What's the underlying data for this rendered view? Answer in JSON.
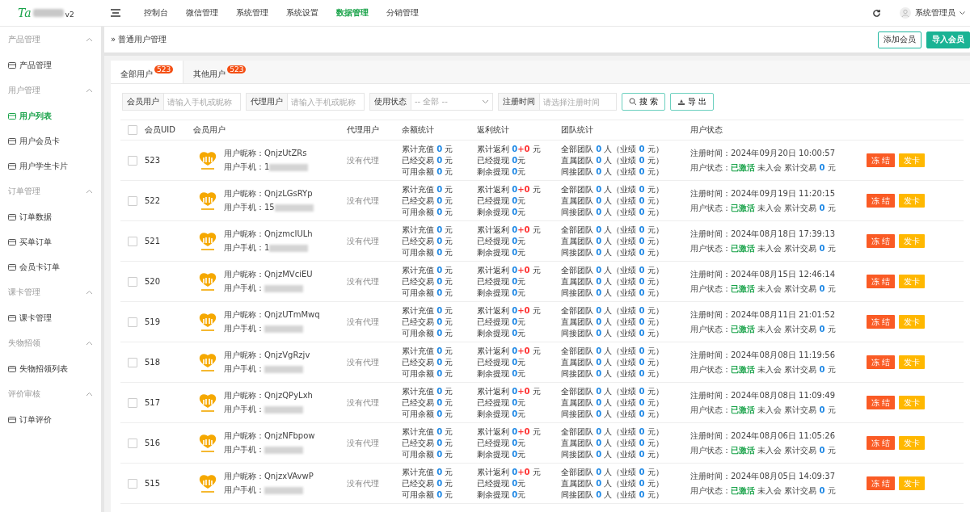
{
  "header": {
    "logo": "Ta",
    "version": "v2",
    "nav": [
      {
        "label": "控制台",
        "selected": false
      },
      {
        "label": "微信管理",
        "selected": false
      },
      {
        "label": "系统管理",
        "selected": false
      },
      {
        "label": "系统设置",
        "selected": false
      },
      {
        "label": "数据管理",
        "selected": true
      },
      {
        "label": "分销管理",
        "selected": false
      }
    ],
    "user": "系统管理员"
  },
  "sidebar": [
    {
      "title": "产品管理",
      "expanded": true,
      "items": [
        {
          "label": "产品管理",
          "selected": false
        }
      ]
    },
    {
      "title": "用户管理",
      "expanded": true,
      "items": [
        {
          "label": "用户列表",
          "selected": true
        },
        {
          "label": "用户会员卡",
          "selected": false
        },
        {
          "label": "用户学生卡片",
          "selected": false
        }
      ]
    },
    {
      "title": "订单管理",
      "expanded": true,
      "items": [
        {
          "label": "订单数据",
          "selected": false
        },
        {
          "label": "买单订单",
          "selected": false
        },
        {
          "label": "会员卡订单",
          "selected": false
        }
      ]
    },
    {
      "title": "课卡管理",
      "expanded": true,
      "items": [
        {
          "label": "课卡管理",
          "selected": false
        }
      ]
    },
    {
      "title": "失物招领",
      "expanded": true,
      "items": [
        {
          "label": "失物招领列表",
          "selected": false
        }
      ]
    },
    {
      "title": "评价审核",
      "expanded": true,
      "items": [
        {
          "label": "订单评价",
          "selected": false
        }
      ]
    }
  ],
  "breadcrumb": "» 普通用户管理",
  "actions": [
    "添加会员",
    "导入会员"
  ],
  "tabs": [
    {
      "label": "全部用户",
      "count": "523",
      "selected": true
    },
    {
      "label": "其他用户",
      "count": "523",
      "selected": false
    }
  ],
  "filters": [
    {
      "label": "会员用户",
      "placeholder": "请输入手机或昵称",
      "kind": "input"
    },
    {
      "label": "代理用户",
      "placeholder": "请输入手机或昵称",
      "kind": "input"
    },
    {
      "label": "使用状态",
      "placeholder": "-- 全部 --",
      "kind": "select"
    },
    {
      "label": "注册时间",
      "placeholder": "请选择注册时间",
      "kind": "input"
    }
  ],
  "search_button": "搜 索",
  "export_button": "导 出",
  "select_all": {
    "checked": false
  },
  "columns": [
    "会员UID",
    "会员用户",
    "代理用户",
    "余额统计",
    "返利统计",
    "团队统计",
    "用户状态"
  ],
  "rows": [
    {
      "checked": false,
      "uid": "523",
      "nick_label": "用户昵称：",
      "nick": "QnjzUtZRs",
      "phone_label": "用户手机：",
      "phone": "1",
      "agent": "没有代理",
      "balance": [
        [
          "累计充值",
          "0",
          "元"
        ],
        [
          "已经交易",
          "0",
          "元"
        ],
        [
          "可用余额",
          "0",
          "元"
        ]
      ],
      "rebate": [
        [
          "累计返利",
          "0",
          "+0",
          "元"
        ],
        [
          "已经提现",
          "0",
          "元"
        ],
        [
          "剩余提现",
          "0",
          "元"
        ]
      ],
      "team": [
        [
          "全部团队",
          "0",
          "人（业绩",
          "0",
          "元）"
        ],
        [
          "直属团队",
          "0",
          "人（业绩",
          "0",
          "元）"
        ],
        [
          "间接团队",
          "0",
          "人（业绩",
          "0",
          "元）"
        ]
      ],
      "reg_label": "注册时间：",
      "reg": "2024年09月20日 10:00:57",
      "status_label": "用户状态：",
      "status": "已激活",
      "member": "未入会",
      "trade_label": "累计交易",
      "trade": "0",
      "trade_unit": "元",
      "freeze": "冻 结",
      "card": "发卡"
    },
    {
      "checked": false,
      "uid": "522",
      "nick_label": "用户昵称：",
      "nick": "QnjzLGsRYp",
      "phone_label": "用户手机：",
      "phone": "15",
      "agent": "没有代理",
      "balance": [
        [
          "累计充值",
          "0",
          "元"
        ],
        [
          "已经交易",
          "0",
          "元"
        ],
        [
          "可用余额",
          "0",
          "元"
        ]
      ],
      "rebate": [
        [
          "累计返利",
          "0",
          "+0",
          "元"
        ],
        [
          "已经提现",
          "0",
          "元"
        ],
        [
          "剩余提现",
          "0",
          "元"
        ]
      ],
      "team": [
        [
          "全部团队",
          "0",
          "人（业绩",
          "0",
          "元）"
        ],
        [
          "直属团队",
          "0",
          "人（业绩",
          "0",
          "元）"
        ],
        [
          "间接团队",
          "0",
          "人（业绩",
          "0",
          "元）"
        ]
      ],
      "reg_label": "注册时间：",
      "reg": "2024年09月19日 11:20:15",
      "status_label": "用户状态：",
      "status": "已激活",
      "member": "未入会",
      "trade_label": "累计交易",
      "trade": "0",
      "trade_unit": "元",
      "freeze": "冻 结",
      "card": "发卡"
    },
    {
      "checked": false,
      "uid": "521",
      "nick_label": "用户昵称：",
      "nick": "QnjzmcIULh",
      "phone_label": "用户手机：",
      "phone": "1",
      "agent": "没有代理",
      "balance": [
        [
          "累计充值",
          "0",
          "元"
        ],
        [
          "已经交易",
          "0",
          "元"
        ],
        [
          "可用余额",
          "0",
          "元"
        ]
      ],
      "rebate": [
        [
          "累计返利",
          "0",
          "+0",
          "元"
        ],
        [
          "已经提现",
          "0",
          "元"
        ],
        [
          "剩余提现",
          "0",
          "元"
        ]
      ],
      "team": [
        [
          "全部团队",
          "0",
          "人（业绩",
          "0",
          "元）"
        ],
        [
          "直属团队",
          "0",
          "人（业绩",
          "0",
          "元）"
        ],
        [
          "间接团队",
          "0",
          "人（业绩",
          "0",
          "元）"
        ]
      ],
      "reg_label": "注册时间：",
      "reg": "2024年08月18日 17:39:13",
      "status_label": "用户状态：",
      "status": "已激活",
      "member": "未入会",
      "trade_label": "累计交易",
      "trade": "0",
      "trade_unit": "元",
      "freeze": "冻 结",
      "card": "发卡"
    },
    {
      "checked": false,
      "uid": "520",
      "nick_label": "用户昵称：",
      "nick": "QnjzMVciEU",
      "phone_label": "用户手机：",
      "agent": "没有代理",
      "balance": [
        [
          "累计充值",
          "0",
          "元"
        ],
        [
          "已经交易",
          "0",
          "元"
        ],
        [
          "可用余额",
          "0",
          "元"
        ]
      ],
      "rebate": [
        [
          "累计返利",
          "0",
          "+0",
          "元"
        ],
        [
          "已经提现",
          "0",
          "元"
        ],
        [
          "剩余提现",
          "0",
          "元"
        ]
      ],
      "team": [
        [
          "全部团队",
          "0",
          "人（业绩",
          "0",
          "元）"
        ],
        [
          "直属团队",
          "0",
          "人（业绩",
          "0",
          "元）"
        ],
        [
          "间接团队",
          "0",
          "人（业绩",
          "0",
          "元）"
        ]
      ],
      "reg_label": "注册时间：",
      "reg": "2024年08月15日 12:46:14",
      "status_label": "用户状态：",
      "status": "已激活",
      "member": "未入会",
      "trade_label": "累计交易",
      "trade": "0",
      "trade_unit": "元",
      "freeze": "冻 结",
      "card": "发卡"
    },
    {
      "checked": false,
      "uid": "519",
      "nick_label": "用户昵称：",
      "nick": "QnjzUTmMwq",
      "phone_label": "用户手机：",
      "agent": "没有代理",
      "balance": [
        [
          "累计充值",
          "0",
          "元"
        ],
        [
          "已经交易",
          "0",
          "元"
        ],
        [
          "可用余额",
          "0",
          "元"
        ]
      ],
      "rebate": [
        [
          "累计返利",
          "0",
          "+0",
          "元"
        ],
        [
          "已经提现",
          "0",
          "元"
        ],
        [
          "剩余提现",
          "0",
          "元"
        ]
      ],
      "team": [
        [
          "全部团队",
          "0",
          "人（业绩",
          "0",
          "元）"
        ],
        [
          "直属团队",
          "0",
          "人（业绩",
          "0",
          "元）"
        ],
        [
          "间接团队",
          "0",
          "人（业绩",
          "0",
          "元）"
        ]
      ],
      "reg_label": "注册时间：",
      "reg": "2024年08月11日 21:01:52",
      "status_label": "用户状态：",
      "status": "已激活",
      "member": "未入会",
      "trade_label": "累计交易",
      "trade": "0",
      "trade_unit": "元",
      "freeze": "冻 结",
      "card": "发卡"
    },
    {
      "checked": false,
      "uid": "518",
      "nick_label": "用户昵称：",
      "nick": "QnjzVgRzjv",
      "phone_label": "用户手机：",
      "agent": "没有代理",
      "balance": [
        [
          "累计充值",
          "0",
          "元"
        ],
        [
          "已经交易",
          "0",
          "元"
        ],
        [
          "可用余额",
          "0",
          "元"
        ]
      ],
      "rebate": [
        [
          "累计返利",
          "0",
          "+0",
          "元"
        ],
        [
          "已经提现",
          "0",
          "元"
        ],
        [
          "剩余提现",
          "0",
          "元"
        ]
      ],
      "team": [
        [
          "全部团队",
          "0",
          "人（业绩",
          "0",
          "元）"
        ],
        [
          "直属团队",
          "0",
          "人（业绩",
          "0",
          "元）"
        ],
        [
          "间接团队",
          "0",
          "人（业绩",
          "0",
          "元）"
        ]
      ],
      "reg_label": "注册时间：",
      "reg": "2024年08月08日 11:19:56",
      "status_label": "用户状态：",
      "status": "已激活",
      "member": "未入会",
      "trade_label": "累计交易",
      "trade": "0",
      "trade_unit": "元",
      "freeze": "冻 结",
      "card": "发卡"
    },
    {
      "checked": false,
      "uid": "517",
      "nick_label": "用户昵称：",
      "nick": "QnjzQPyLxh",
      "phone_label": "用户手机：",
      "agent": "没有代理",
      "balance": [
        [
          "累计充值",
          "0",
          "元"
        ],
        [
          "已经交易",
          "0",
          "元"
        ],
        [
          "可用余额",
          "0",
          "元"
        ]
      ],
      "rebate": [
        [
          "累计返利",
          "0",
          "+0",
          "元"
        ],
        [
          "已经提现",
          "0",
          "元"
        ],
        [
          "剩余提现",
          "0",
          "元"
        ]
      ],
      "team": [
        [
          "全部团队",
          "0",
          "人（业绩",
          "0",
          "元）"
        ],
        [
          "直属团队",
          "0",
          "人（业绩",
          "0",
          "元）"
        ],
        [
          "间接团队",
          "0",
          "人（业绩",
          "0",
          "元）"
        ]
      ],
      "reg_label": "注册时间：",
      "reg": "2024年08月08日 11:09:49",
      "status_label": "用户状态：",
      "status": "已激活",
      "member": "未入会",
      "trade_label": "累计交易",
      "trade": "0",
      "trade_unit": "元",
      "freeze": "冻 结",
      "card": "发卡"
    },
    {
      "checked": false,
      "uid": "516",
      "nick_label": "用户昵称：",
      "nick": "QnjzNFbpow",
      "phone_label": "用户手机：",
      "agent": "没有代理",
      "balance": [
        [
          "累计充值",
          "0",
          "元"
        ],
        [
          "已经交易",
          "0",
          "元"
        ],
        [
          "可用余额",
          "0",
          "元"
        ]
      ],
      "rebate": [
        [
          "累计返利",
          "0",
          "+0",
          "元"
        ],
        [
          "已经提现",
          "0",
          "元"
        ],
        [
          "剩余提现",
          "0",
          "元"
        ]
      ],
      "team": [
        [
          "全部团队",
          "0",
          "人（业绩",
          "0",
          "元）"
        ],
        [
          "直属团队",
          "0",
          "人（业绩",
          "0",
          "元）"
        ],
        [
          "间接团队",
          "0",
          "人（业绩",
          "0",
          "元）"
        ]
      ],
      "reg_label": "注册时间：",
      "reg": "2024年08月06日 11:05:26",
      "status_label": "用户状态：",
      "status": "已激活",
      "member": "未入会",
      "trade_label": "累计交易",
      "trade": "0",
      "trade_unit": "元",
      "freeze": "冻 结",
      "card": "发卡"
    },
    {
      "checked": false,
      "uid": "515",
      "nick_label": "用户昵称：",
      "nick": "QnjzxVAvwP",
      "phone_label": "用户手机：",
      "agent": "没有代理",
      "balance": [
        [
          "累计充值",
          "0",
          "元"
        ],
        [
          "已经交易",
          "0",
          "元"
        ],
        [
          "可用余额",
          "0",
          "元"
        ]
      ],
      "rebate": [
        [
          "累计返利",
          "0",
          "+0",
          "元"
        ],
        [
          "已经提现",
          "0",
          "元"
        ],
        [
          "剩余提现",
          "0",
          "元"
        ]
      ],
      "team": [
        [
          "全部团队",
          "0",
          "人（业绩",
          "0",
          "元）"
        ],
        [
          "直属团队",
          "0",
          "人（业绩",
          "0",
          "元）"
        ],
        [
          "间接团队",
          "0",
          "人（业绩",
          "0",
          "元）"
        ]
      ],
      "reg_label": "注册时间：",
      "reg": "2024年08月05日 14:09:37",
      "status_label": "用户状态：",
      "status": "已激活",
      "member": "未入会",
      "trade_label": "累计交易",
      "trade": "0",
      "trade_unit": "元",
      "freeze": "冻 结",
      "card": "发卡"
    }
  ]
}
